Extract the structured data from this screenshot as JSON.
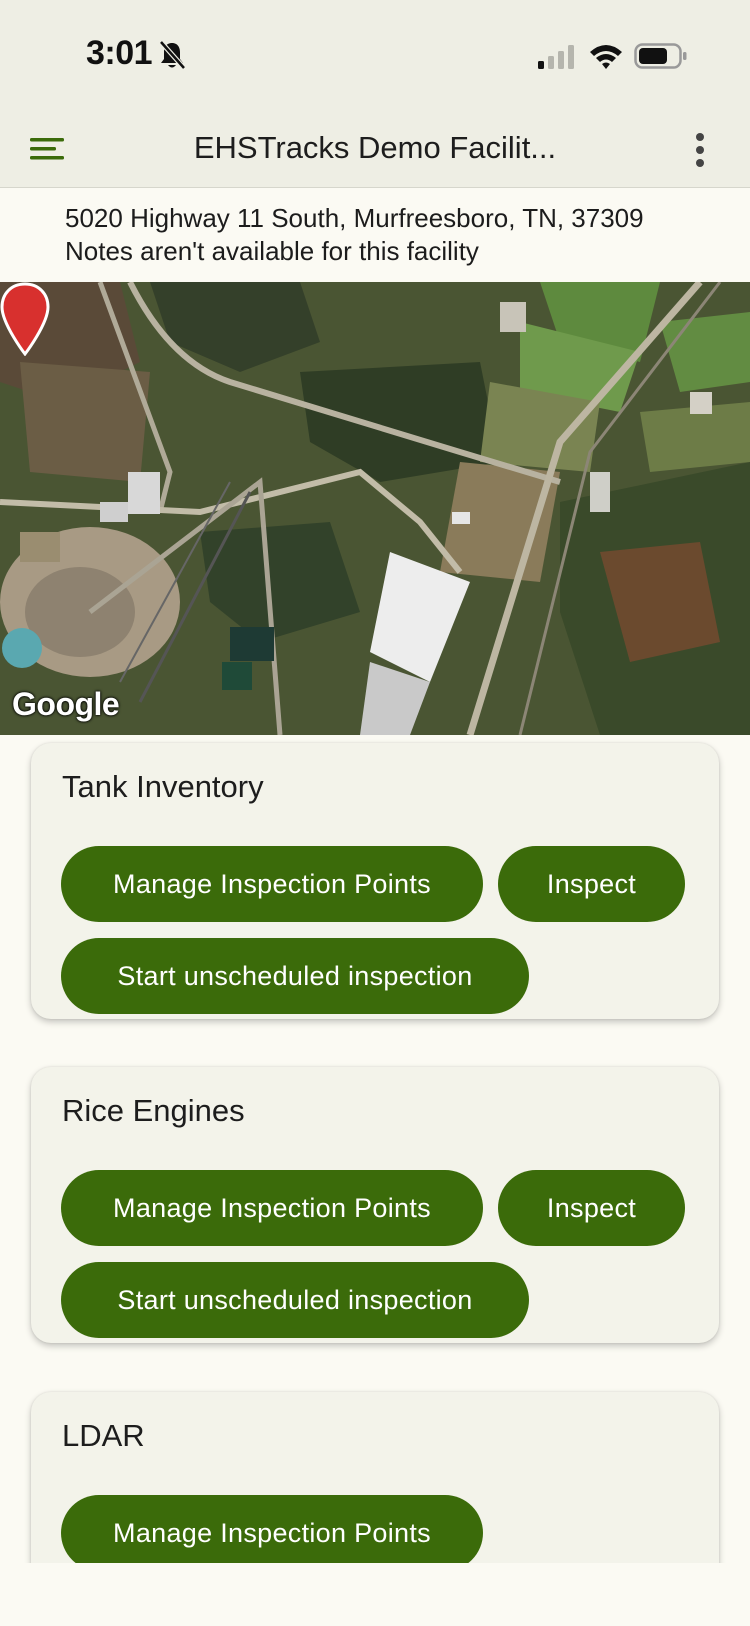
{
  "status_bar": {
    "time": "3:01",
    "icons": [
      "bell-off-icon",
      "signal-icon",
      "wifi-icon",
      "battery-icon"
    ]
  },
  "app_bar": {
    "title": "EHSTracks Demo Facilit...",
    "menu_icon": "hamburger-menu-icon",
    "more_icon": "more-vertical-icon"
  },
  "facility": {
    "address": "5020 Highway 11 South, Murfreesboro, TN, 37309",
    "notes": "Notes aren't available for this facility"
  },
  "map": {
    "attribution": "Google",
    "marker_icon": "map-pin-icon"
  },
  "cards": [
    {
      "title": "Tank Inventory",
      "manage_label": "Manage Inspection Points",
      "inspect_label": "Inspect",
      "unscheduled_label": "Start unscheduled inspection"
    },
    {
      "title": "Rice Engines",
      "manage_label": "Manage Inspection Points",
      "inspect_label": "Inspect",
      "unscheduled_label": "Start unscheduled inspection"
    },
    {
      "title": "LDAR",
      "manage_label": "Manage Inspection Points"
    }
  ],
  "colors": {
    "primary_button": "#3b6b0a",
    "app_bar_bg": "#eeeee4",
    "card_bg": "#f3f3ea",
    "page_bg": "#fbfaf3",
    "marker": "#d8302e"
  }
}
